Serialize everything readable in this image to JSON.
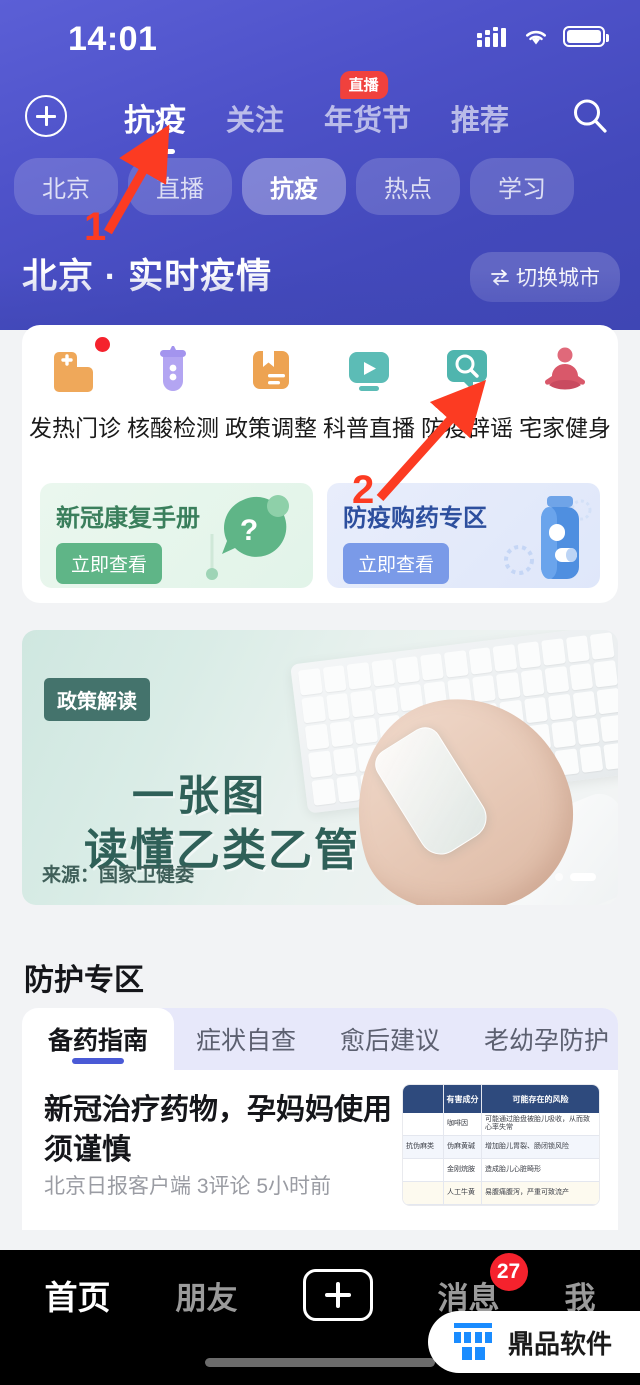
{
  "status_bar": {
    "time": "14:01",
    "signal_icon": "signal-bars-icon",
    "wifi_icon": "wifi-icon",
    "battery_icon": "battery-icon"
  },
  "top_nav": {
    "add_button_icon": "plus-circle-icon",
    "search_icon": "search-icon",
    "tabs": [
      {
        "label": "抗疫",
        "active": true
      },
      {
        "label": "关注",
        "active": false
      },
      {
        "label": "年货节",
        "active": false,
        "badge": "直播"
      },
      {
        "label": "推荐",
        "active": false
      }
    ]
  },
  "chips": [
    {
      "label": "北京",
      "active": false
    },
    {
      "label": "直播",
      "active": false
    },
    {
      "label": "抗疫",
      "active": true
    },
    {
      "label": "热点",
      "active": false
    },
    {
      "label": "学习",
      "active": false
    }
  ],
  "city_section": {
    "title": "北京 · 实时疫情",
    "switch_city_label": "切换城市",
    "switch_city_icon": "swap-arrows-icon"
  },
  "services": [
    {
      "label": "发热门诊",
      "icon": "hospital-plus-icon",
      "color": "#efa85a",
      "badge": true
    },
    {
      "label": "核酸检测",
      "icon": "test-tube-icon",
      "color": "#a394ee"
    },
    {
      "label": "政策调整",
      "icon": "book-bookmark-icon",
      "color": "#eda352"
    },
    {
      "label": "科普直播",
      "icon": "video-play-icon",
      "color": "#5cbcb6"
    },
    {
      "label": "防疫辟谣",
      "icon": "search-bubble-icon",
      "color": "#4fb5ae"
    },
    {
      "label": "宅家健身",
      "icon": "meditation-icon",
      "color": "#d9586a"
    }
  ],
  "promos": [
    {
      "title": "新冠康复手册",
      "button": "立即查看",
      "theme": "green",
      "art_icon": "question-bubble-icon"
    },
    {
      "title": "防疫购药专区",
      "button": "立即查看",
      "theme": "blue",
      "art_icon": "medicine-bottle-icon"
    }
  ],
  "banner": {
    "tag": "政策解读",
    "line1": "一张图",
    "line2": "读懂乙类乙管",
    "source": "来源：国家卫健委",
    "dots_total": 2,
    "dots_active_index": 1
  },
  "protection": {
    "section_title": "防护专区",
    "tabs": [
      {
        "label": "备药指南",
        "active": true
      },
      {
        "label": "症状自查",
        "active": false
      },
      {
        "label": "愈后建议",
        "active": false
      },
      {
        "label": "老幼孕防护",
        "active": false
      }
    ],
    "article": {
      "title": "新冠治疗药物，孕妈妈使用须谨慎",
      "source": "北京日报客户端",
      "comments": "3评论",
      "time": "5小时前",
      "meta": "北京日报客户端  3评论  5小时前",
      "thumbnail": {
        "headers": [
          "",
          "有害成分",
          "可能存在的风险"
        ],
        "rows": [
          [
            "",
            "咖啡因",
            "可能通过胎盘被胎儿吸收，从而致心率失常"
          ],
          [
            "抗伪麻类",
            "伪麻黄碱",
            "增加胎儿胃裂、肠闭锁风险"
          ],
          [
            "",
            "金刚烷胺",
            "造成胎儿心脏畸形"
          ],
          [
            "",
            "人工牛黄",
            "易腹痛腹泻，严重可致流产"
          ]
        ]
      }
    }
  },
  "bottom_nav": {
    "items": [
      {
        "label": "首页",
        "active": true
      },
      {
        "label": "朋友",
        "active": false
      },
      {
        "label": "+",
        "type": "plus",
        "icon": "plus-square-icon"
      },
      {
        "label": "消息",
        "active": false,
        "badge": "27"
      },
      {
        "label": "我",
        "active": false
      }
    ]
  },
  "watermark": {
    "text": "鼎品软件",
    "logo_icon": "ding-logo-icon"
  },
  "annotations": [
    {
      "number": "1",
      "target": "抗疫 tab"
    },
    {
      "number": "2",
      "target": "防疫辟谣 icon"
    }
  ],
  "colors": {
    "header_blue": "#4a50c4",
    "accent_blue": "#4a5ad6",
    "badge_red": "#f5222d",
    "annotation_red": "#fc3b22"
  }
}
